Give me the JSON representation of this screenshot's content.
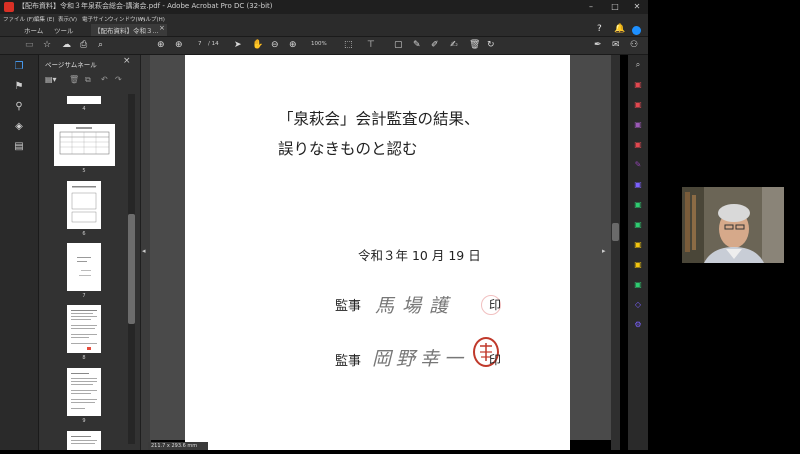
{
  "titlebar": {
    "title": "【配布資料】令和３年泉萩会総会-講演会.pdf - Adobe Acrobat Pro DC (32-bit)",
    "minimize": "–",
    "maximize": "□",
    "close": "✕"
  },
  "menu": [
    "ファイル (F)",
    "編集 (E)",
    "表示(V)",
    "電子サイン",
    "ウィンドウ(W)",
    "ヘルプ(H)"
  ],
  "tabs": {
    "home": "ホーム",
    "tools": "ツール",
    "doc": "【配布資料】令和３...",
    "doc_close": "×"
  },
  "toolbar": {
    "page_current": "7",
    "page_total": "/ 14",
    "zoom": "100%"
  },
  "thumbnails": {
    "title": "ページサムネール",
    "close": "×",
    "pages": [
      "4",
      "5",
      "6",
      "7",
      "8",
      "9"
    ]
  },
  "document": {
    "line1": "「泉萩会」会計監査の結果、",
    "line2": "誤りなきものと認む",
    "date": "令和３年 10 月 19 日",
    "auditor_label_1": "監事",
    "auditor_label_2": "監事",
    "seal_text_1": "印",
    "seal_text_2": "印",
    "signature_1": "馬場護",
    "signature_2": "岡野幸一"
  },
  "status": {
    "page_size": "211.7 x 293.6 mm"
  },
  "colors": {
    "accent_blue": "#1e90ff",
    "seal_red": "#c0392b",
    "right_tool_colors": [
      "#e34850",
      "#e34850",
      "#9b59b6",
      "#e34850",
      "#8e44ad",
      "#7b61ff",
      "#2ecc71",
      "#2ecc71",
      "#f1c40f",
      "#f1c40f",
      "#2ecc71",
      "#7b61ff",
      "#7b61ff"
    ]
  }
}
